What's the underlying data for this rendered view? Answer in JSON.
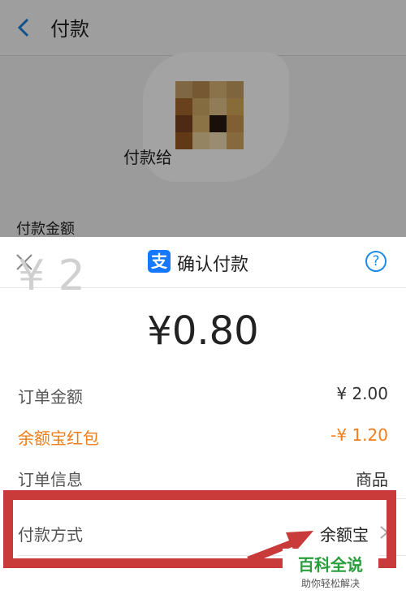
{
  "background_page": {
    "title": "付款",
    "pay_to_label": "付款给",
    "amount_label": "付款金额",
    "ghost_amount": "¥ 2"
  },
  "sheet": {
    "title": "确认付款",
    "amount": "¥0.80",
    "rows": [
      {
        "label": "订单金额",
        "value": "¥ 2.00"
      },
      {
        "label": "余额宝红包",
        "value": "-¥ 1.20"
      },
      {
        "label": "订单信息",
        "value": "商品"
      },
      {
        "label": "付款方式",
        "value": "余额宝"
      }
    ]
  },
  "watermark": {
    "title": "百科全说",
    "subtitle": "助你轻松解决"
  },
  "colors": {
    "accent_blue": "#1677ff",
    "orange": "#f07d1a",
    "highlight_red": "#c93a3a",
    "watermark_green": "#2a9d3c"
  },
  "icons": [
    "back-arrow-icon",
    "close-icon",
    "alipay-logo-icon",
    "help-icon",
    "chevron-right-icon"
  ]
}
